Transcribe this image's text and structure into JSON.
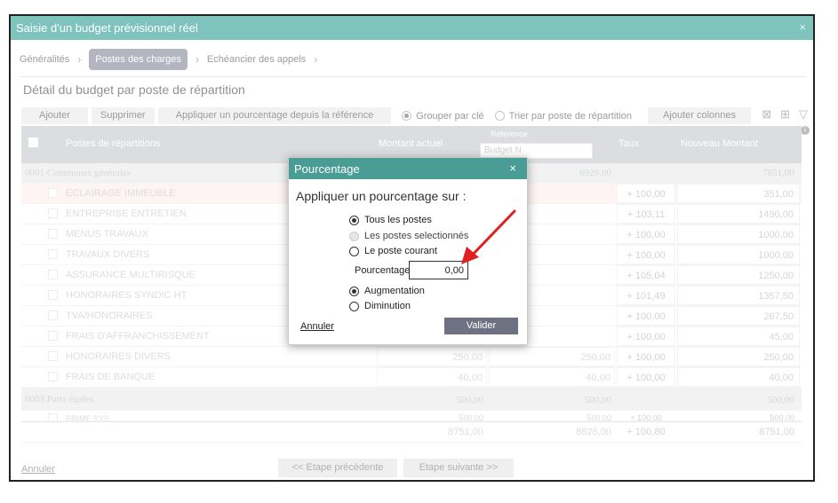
{
  "window": {
    "title": "Saisie d'un budget prévisionnel réel",
    "close_glyph": "×"
  },
  "steps": [
    "Généralités",
    "Postes des charges",
    "Echéancier des appels"
  ],
  "heading": "Détail du budget par poste de répartition",
  "toolbar": {
    "add": "Ajouter",
    "delete": "Supprimer",
    "apply_pct": "Appliquer un pourcentage depuis la référence",
    "group_by_key": "Grouper par clé",
    "sort_by_post": "Trier par poste de répartition",
    "add_columns": "Ajouter colonnes"
  },
  "grid": {
    "headers": {
      "post": "Postes de répartitions",
      "current": "Montant actuel",
      "reference_label": "Référence",
      "reference_placeholder": "Budget N",
      "rate": "Taux",
      "new_amount": "Nouveau Montant"
    },
    "groups": [
      {
        "name": "0001 Communes générales",
        "reference": "6926,00",
        "new_amount": "7851,00",
        "rows": [
          {
            "label": "ECLAIRAGE IMMEUBLE",
            "rate": "+ 100,00",
            "new": "351,00",
            "highlight": true
          },
          {
            "label": "ENTREPRISE ENTRETIEN",
            "rate": "+ 103,11",
            "new": "1490,00"
          },
          {
            "label": "MENUS TRAVAUX",
            "rate": "+ 100,00",
            "new": "1000,00"
          },
          {
            "label": "TRAVAUX DIVERS",
            "rate": "+ 100,00",
            "new": "1000,00"
          },
          {
            "label": "ASSURANCE MULTIRISQUE",
            "rate": "+ 105,04",
            "new": "1250,00"
          },
          {
            "label": "HONORAIRES SYNDIC HT",
            "rate": "+ 101,49",
            "new": "1357,50"
          },
          {
            "label": "TVA/HONORAIRES",
            "rate": "+ 100,00",
            "new": "267,50"
          },
          {
            "label": "FRAIS D'AFFRANCHISSEMENT",
            "rate": "+ 100,00",
            "new": "45,00"
          },
          {
            "label": "HONORAIRES DIVERS",
            "current": "250,00",
            "reference": "250,00",
            "rate": "+ 100,00",
            "new": "250,00"
          },
          {
            "label": "FRAIS DE BANQUE",
            "current": "40,00",
            "reference": "40,00",
            "rate": "+ 100,00",
            "new": "40,00"
          }
        ]
      },
      {
        "name": "0003 Parts égales",
        "current": "500,00",
        "reference": "500,00",
        "new_amount": "500,00",
        "rows": [
          {
            "label": "PRIME SYS",
            "current": "500,00",
            "reference": "500,00",
            "rate": "+ 100,00",
            "new": "500,00"
          }
        ]
      }
    ],
    "totals": {
      "current": "8751,00",
      "reference": "8626,00",
      "rate": "+ 100,80",
      "new": "8751,00"
    }
  },
  "footer": {
    "cancel": "Annuler",
    "prev": "<< Etape précédente",
    "next": "Etape suivante >>"
  },
  "modal": {
    "title": "Pourcentage",
    "close_glyph": "×",
    "subtitle": "Appliquer un pourcentage sur :",
    "scope_options": [
      "Tous les postes",
      "Les postes selectionnés",
      "Le poste courant"
    ],
    "scope_selected": "Tous les postes",
    "percentage_label": "Pourcentage",
    "percentage_value": "0,00",
    "direction_options": [
      "Augmentation",
      "Diminution"
    ],
    "direction_selected": "Augmentation",
    "cancel": "Annuler",
    "ok": "Valider"
  },
  "colors": {
    "title_bar": "#7fc3bd",
    "modal_title": "#4a9d95",
    "active_step": "#8a8fa0",
    "arrow": "#e02020",
    "validate_button": "#6d7182"
  }
}
